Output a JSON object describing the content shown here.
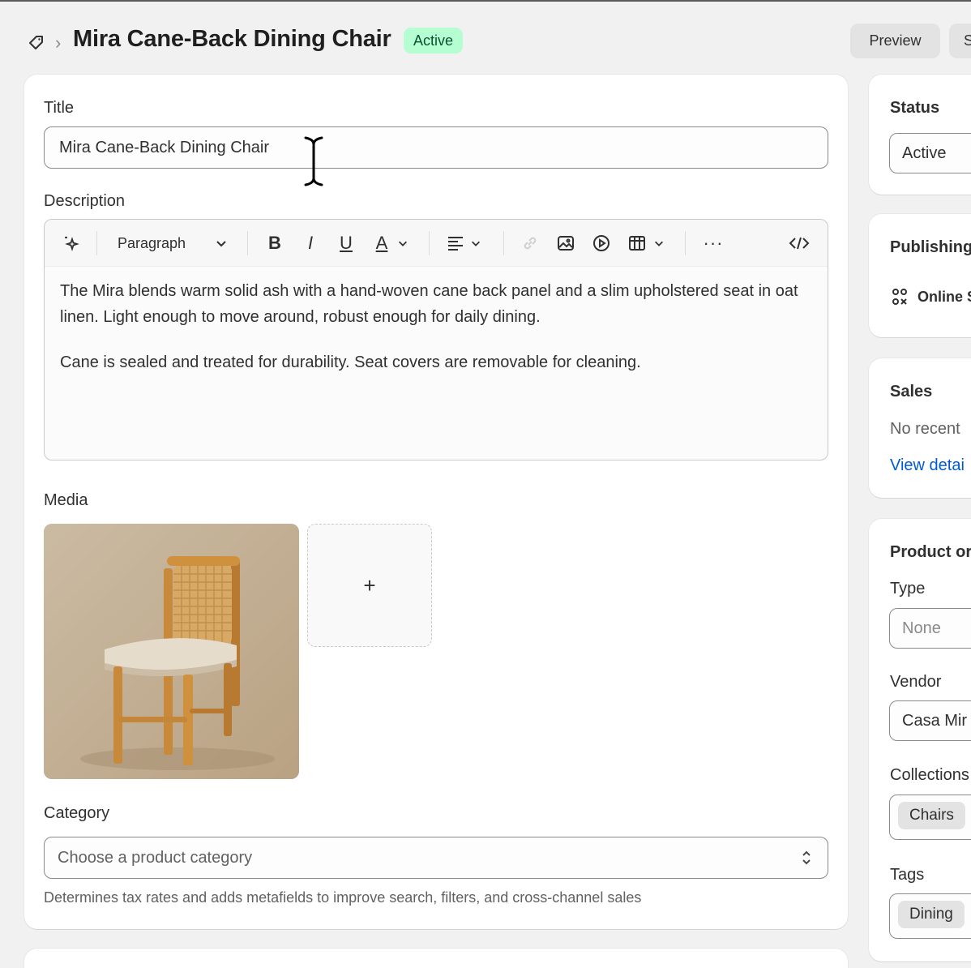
{
  "header": {
    "title": "Mira Cane-Back Dining Chair",
    "status_badge": "Active",
    "preview_label": "Preview",
    "more_label": "S"
  },
  "product": {
    "title_label": "Title",
    "title_value": "Mira Cane-Back Dining Chair",
    "description_label": "Description",
    "toolbar": {
      "paragraph_label": "Paragraph"
    },
    "description_paragraphs": [
      "The Mira blends warm solid ash with a hand-woven cane back panel and a slim upholstered seat in oat linen. Light enough to move around, robust enough for daily dining.",
      "Cane is sealed and treated for durability. Seat covers are removable for cleaning."
    ],
    "media_label": "Media",
    "media_add_label": "+",
    "category_label": "Category",
    "category_placeholder": "Choose a product category",
    "category_help": "Determines tax rates and adds metafields to improve search, filters, and cross-channel sales"
  },
  "sidebar": {
    "status": {
      "title": "Status",
      "value": "Active"
    },
    "publishing": {
      "title": "Publishing",
      "channel": "Online S"
    },
    "sales": {
      "title": "Sales",
      "text": "No recent",
      "link": "View detai"
    },
    "organization": {
      "title": "Product or",
      "type_label": "Type",
      "type_value": "None",
      "vendor_label": "Vendor",
      "vendor_value": "Casa Mir",
      "collections_label": "Collections",
      "collection_chip": "Chairs",
      "tags_label": "Tags",
      "tag_chip": "Dining"
    }
  },
  "colors": {
    "background": "#f1f1f1",
    "card": "#ffffff",
    "badge_bg": "#b4fed2",
    "badge_text": "#0c5132",
    "link": "#005bd3"
  }
}
